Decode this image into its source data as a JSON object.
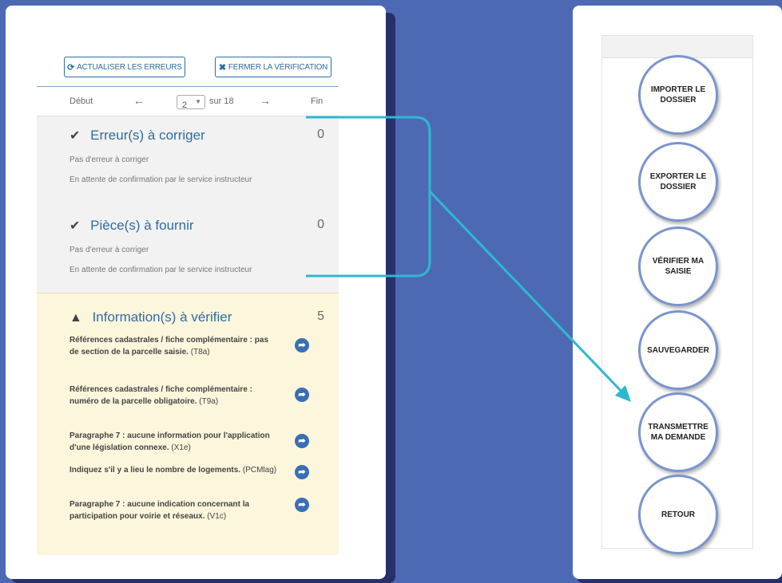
{
  "toolbar": {
    "refresh_label": "ACTUALISER LES ERREURS",
    "close_label": "FERMER LA VÉRIFICATION"
  },
  "pager": {
    "first": "Début",
    "current": "2",
    "of": "sur 18",
    "last": "Fin"
  },
  "errors": {
    "title": "Erreur(s) à corriger",
    "count": "0",
    "line1": "Pas d'erreur à corriger",
    "line2": "En attente de confirmation par le service instructeur"
  },
  "pieces": {
    "title": "Pièce(s) à fournir",
    "count": "0",
    "line1": "Pas d'erreur à corriger",
    "line2": "En attente de confirmation par le service instructeur"
  },
  "info": {
    "title": "Information(s) à vérifier",
    "count": "5",
    "items": [
      {
        "text": "Références cadastrales / fiche complémentaire : pas de section de la parcelle saisie.",
        "code": "(T8a)"
      },
      {
        "text": "Références cadastrales / fiche complémentaire : numéro de la parcelle obligatoire.",
        "code": "(T9a)"
      },
      {
        "text": "Paragraphe 7 : aucune information pour l'application d'une législation connexe.",
        "code": "(X1e)"
      },
      {
        "text": "Indiquez s'il y a lieu le nombre de logements.",
        "code": "(PCMlag)"
      },
      {
        "text": "Paragraphe 7 : aucune indication concernant la participation pour voirie et réseaux.",
        "code": "(V1c)"
      }
    ]
  },
  "actions": {
    "import": "IMPORTER LE DOSSIER",
    "export": "EXPORTER LE DOSSIER",
    "verify": "VÉRIFIER MA SAISIE",
    "save": "SAUVEGARDER",
    "transmit": "TRANSMETTRE MA DEMANDE",
    "back": "RETOUR"
  },
  "colors": {
    "background": "#4e69b4",
    "accent": "#2e6da4",
    "connector": "#2eb8d0",
    "info_bg": "#fcf6dc"
  }
}
